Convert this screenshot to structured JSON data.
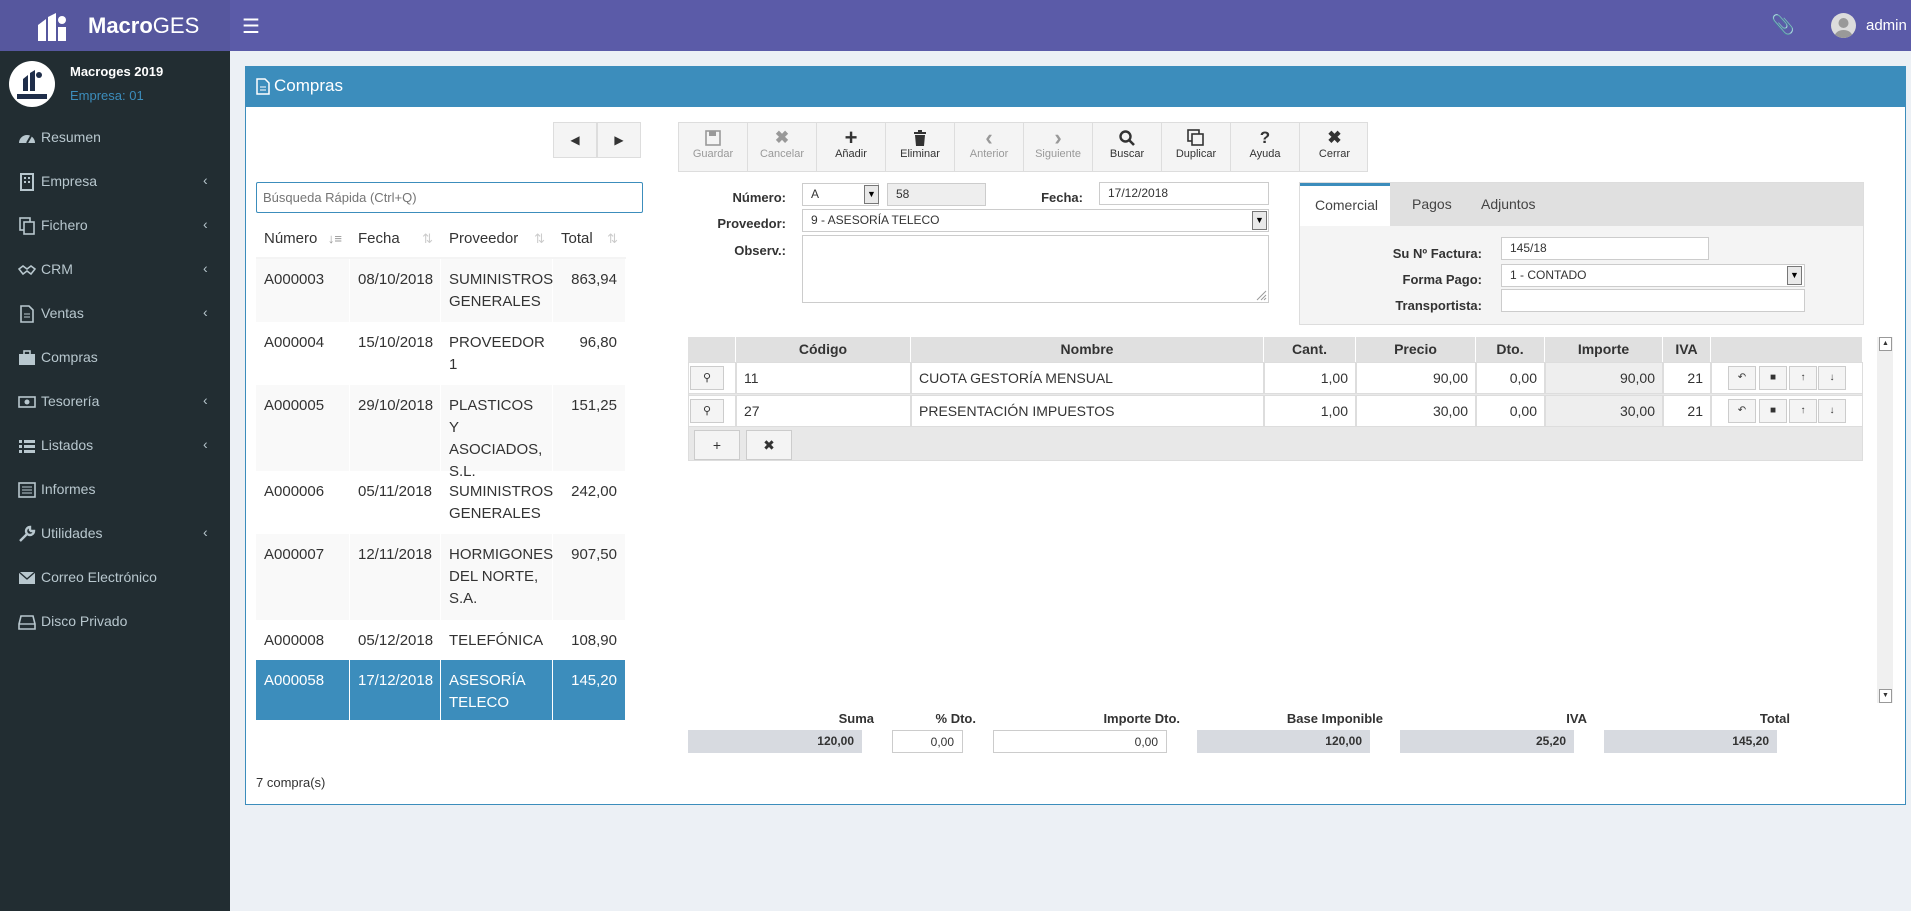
{
  "app": {
    "brand_bold": "Macro",
    "brand_light": "GES",
    "user": "admin"
  },
  "sidebar": {
    "company": "Macroges 2019",
    "empresa": "Empresa: 01",
    "items": [
      {
        "label": "Resumen"
      },
      {
        "label": "Empresa"
      },
      {
        "label": "Fichero"
      },
      {
        "label": "CRM"
      },
      {
        "label": "Ventas"
      },
      {
        "label": "Compras"
      },
      {
        "label": "Tesorería"
      },
      {
        "label": "Listados"
      },
      {
        "label": "Informes"
      },
      {
        "label": "Utilidades"
      },
      {
        "label": "Correo Electrónico"
      },
      {
        "label": "Disco Privado"
      }
    ]
  },
  "page": {
    "title": "Compras"
  },
  "search": {
    "placeholder": "Búsqueda Rápida (Ctrl+Q)"
  },
  "list": {
    "headers": [
      "Número",
      "Fecha",
      "Proveedor",
      "Total"
    ],
    "rows": [
      {
        "numero": "A000003",
        "fecha": "08/10/2018",
        "proveedor": "SUMINISTROS GENERALES",
        "total": "863,94"
      },
      {
        "numero": "A000004",
        "fecha": "15/10/2018",
        "proveedor": "PROVEEDOR 1",
        "total": "96,80"
      },
      {
        "numero": "A000005",
        "fecha": "29/10/2018",
        "proveedor": "PLASTICOS Y ASOCIADOS, S.L.",
        "total": "151,25"
      },
      {
        "numero": "A000006",
        "fecha": "05/11/2018",
        "proveedor": "SUMINISTROS GENERALES",
        "total": "242,00"
      },
      {
        "numero": "A000007",
        "fecha": "12/11/2018",
        "proveedor": "HORMIGONES DEL NORTE, S.A.",
        "total": "907,50"
      },
      {
        "numero": "A000008",
        "fecha": "05/12/2018",
        "proveedor": "TELEFÓNICA",
        "total": "108,90"
      },
      {
        "numero": "A000058",
        "fecha": "17/12/2018",
        "proveedor": "ASESORÍA TELECO",
        "total": "145,20"
      }
    ],
    "count": "7 compra(s)"
  },
  "toolbar": {
    "buttons": [
      {
        "label": "Guardar",
        "icon": "floppy-icon"
      },
      {
        "label": "Cancelar",
        "icon": "x-icon"
      },
      {
        "label": "Añadir",
        "icon": "plus-icon"
      },
      {
        "label": "Eliminar",
        "icon": "trash-icon"
      },
      {
        "label": "Anterior",
        "icon": "chevron-left-icon"
      },
      {
        "label": "Siguiente",
        "icon": "chevron-right-icon"
      },
      {
        "label": "Buscar",
        "icon": "search-icon"
      },
      {
        "label": "Duplicar",
        "icon": "copy-icon"
      },
      {
        "label": "Ayuda",
        "icon": "question-icon"
      },
      {
        "label": "Cerrar",
        "icon": "close-icon"
      }
    ]
  },
  "form": {
    "numero_label": "Número:",
    "serie": "A",
    "numero": "58",
    "fecha_label": "Fecha:",
    "fecha": "17/12/2018",
    "proveedor_label": "Proveedor:",
    "proveedor": "9 - ASESORÍA TELECO",
    "observ_label": "Observ.:"
  },
  "tabs": {
    "items": [
      "Comercial",
      "Pagos",
      "Adjuntos"
    ],
    "su_factura_label": "Su Nº Factura:",
    "su_factura": "145/18",
    "forma_pago_label": "Forma Pago:",
    "forma_pago": "1 - CONTADO",
    "transportista_label": "Transportista:",
    "transportista": ""
  },
  "lines": {
    "headers": [
      "Código",
      "Nombre",
      "Cant.",
      "Precio",
      "Dto.",
      "Importe",
      "IVA"
    ],
    "rows": [
      {
        "codigo": "11",
        "nombre": "CUOTA GESTORÍA MENSUAL",
        "cant": "1,00",
        "precio": "90,00",
        "dto": "0,00",
        "importe": "90,00",
        "iva": "21"
      },
      {
        "codigo": "27",
        "nombre": "PRESENTACIÓN IMPUESTOS",
        "cant": "1,00",
        "precio": "30,00",
        "dto": "0,00",
        "importe": "30,00",
        "iva": "21"
      }
    ]
  },
  "totals": {
    "suma_label": "Suma",
    "suma": "120,00",
    "pdto_label": "% Dto.",
    "pdto": "0,00",
    "idto_label": "Importe Dto.",
    "idto": "0,00",
    "base_label": "Base Imponible",
    "base": "120,00",
    "iva_label": "IVA",
    "iva": "25,20",
    "total_label": "Total",
    "total": "145,20"
  },
  "colors": {
    "topbar": "#5b5ba8",
    "sidebar": "#222d32",
    "accent": "#3c8dbc"
  }
}
